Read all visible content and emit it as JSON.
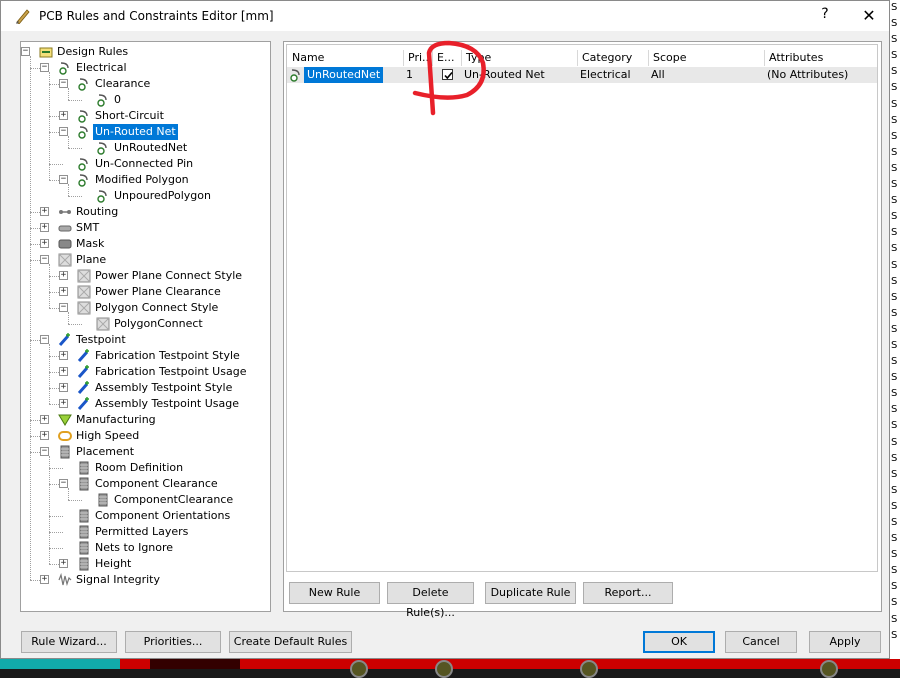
{
  "window": {
    "title": "PCB Rules and Constraints Editor [mm]",
    "help_label": "?",
    "close_label": "✕"
  },
  "tree": [
    {
      "label": "Design Rules",
      "depth": 0,
      "exp": "−",
      "icon": "design-rules-icon"
    },
    {
      "label": "Electrical",
      "depth": 1,
      "exp": "−",
      "icon": "electrical-icon"
    },
    {
      "label": "Clearance",
      "depth": 2,
      "exp": "−",
      "icon": "rule-icon"
    },
    {
      "label": "0",
      "depth": 3,
      "exp": "",
      "icon": "rule-instance-icon"
    },
    {
      "label": "Short-Circuit",
      "depth": 2,
      "exp": "+",
      "icon": "rule-icon"
    },
    {
      "label": "Un-Routed Net",
      "depth": 2,
      "exp": "−",
      "icon": "rule-icon",
      "selected": true
    },
    {
      "label": "UnRoutedNet",
      "depth": 3,
      "exp": "",
      "icon": "rule-instance-icon"
    },
    {
      "label": "Un-Connected Pin",
      "depth": 2,
      "exp": "",
      "icon": "rule-icon"
    },
    {
      "label": "Modified Polygon",
      "depth": 2,
      "exp": "−",
      "icon": "rule-icon"
    },
    {
      "label": "UnpouredPolygon",
      "depth": 3,
      "exp": "",
      "icon": "rule-instance-icon"
    },
    {
      "label": "Routing",
      "depth": 1,
      "exp": "+",
      "icon": "routing-icon"
    },
    {
      "label": "SMT",
      "depth": 1,
      "exp": "+",
      "icon": "smt-icon"
    },
    {
      "label": "Mask",
      "depth": 1,
      "exp": "+",
      "icon": "mask-icon"
    },
    {
      "label": "Plane",
      "depth": 1,
      "exp": "−",
      "icon": "plane-icon"
    },
    {
      "label": "Power Plane Connect Style",
      "depth": 2,
      "exp": "+",
      "icon": "plane-icon"
    },
    {
      "label": "Power Plane Clearance",
      "depth": 2,
      "exp": "+",
      "icon": "plane-icon"
    },
    {
      "label": "Polygon Connect Style",
      "depth": 2,
      "exp": "−",
      "icon": "plane-icon"
    },
    {
      "label": "PolygonConnect",
      "depth": 3,
      "exp": "",
      "icon": "plane-icon"
    },
    {
      "label": "Testpoint",
      "depth": 1,
      "exp": "−",
      "icon": "testpoint-icon"
    },
    {
      "label": "Fabrication Testpoint Style",
      "depth": 2,
      "exp": "+",
      "icon": "testpoint-icon"
    },
    {
      "label": "Fabrication Testpoint Usage",
      "depth": 2,
      "exp": "+",
      "icon": "testpoint-icon"
    },
    {
      "label": "Assembly Testpoint Style",
      "depth": 2,
      "exp": "+",
      "icon": "testpoint-icon"
    },
    {
      "label": "Assembly Testpoint Usage",
      "depth": 2,
      "exp": "+",
      "icon": "testpoint-icon"
    },
    {
      "label": "Manufacturing",
      "depth": 1,
      "exp": "+",
      "icon": "manufacturing-icon"
    },
    {
      "label": "High Speed",
      "depth": 1,
      "exp": "+",
      "icon": "high-speed-icon"
    },
    {
      "label": "Placement",
      "depth": 1,
      "exp": "−",
      "icon": "placement-icon"
    },
    {
      "label": "Room Definition",
      "depth": 2,
      "exp": "",
      "icon": "placement-icon"
    },
    {
      "label": "Component Clearance",
      "depth": 2,
      "exp": "−",
      "icon": "placement-icon"
    },
    {
      "label": "ComponentClearance",
      "depth": 3,
      "exp": "",
      "icon": "placement-icon"
    },
    {
      "label": "Component Orientations",
      "depth": 2,
      "exp": "",
      "icon": "placement-icon"
    },
    {
      "label": "Permitted Layers",
      "depth": 2,
      "exp": "",
      "icon": "placement-icon"
    },
    {
      "label": "Nets to Ignore",
      "depth": 2,
      "exp": "",
      "icon": "placement-icon"
    },
    {
      "label": "Height",
      "depth": 2,
      "exp": "+",
      "icon": "placement-icon"
    },
    {
      "label": "Signal Integrity",
      "depth": 1,
      "exp": "+",
      "icon": "signal-integrity-icon"
    }
  ],
  "table": {
    "columns": [
      "Name",
      "Pri...",
      "E... /",
      "Type",
      "Category",
      "Scope",
      "Attributes"
    ],
    "rows": [
      {
        "name": "UnRoutedNet",
        "priority": "1",
        "enabled": true,
        "type": "Un-Routed Net",
        "category": "Electrical",
        "scope": "All",
        "attributes": "(No Attributes)"
      }
    ]
  },
  "list_buttons": {
    "new_rule": "New Rule",
    "delete_rules": "Delete Rule(s)...",
    "duplicate_rule": "Duplicate Rule",
    "report": "Report..."
  },
  "footer_buttons": {
    "rule_wizard": "Rule Wizard...",
    "priorities": "Priorities...",
    "create_default_rules": "Create Default Rules",
    "ok": "OK",
    "cancel": "Cancel",
    "apply": "Apply"
  },
  "colors": {
    "selection": "#0078d7",
    "annotation_red": "#e8202a",
    "pcb_background": "#ff0000"
  }
}
